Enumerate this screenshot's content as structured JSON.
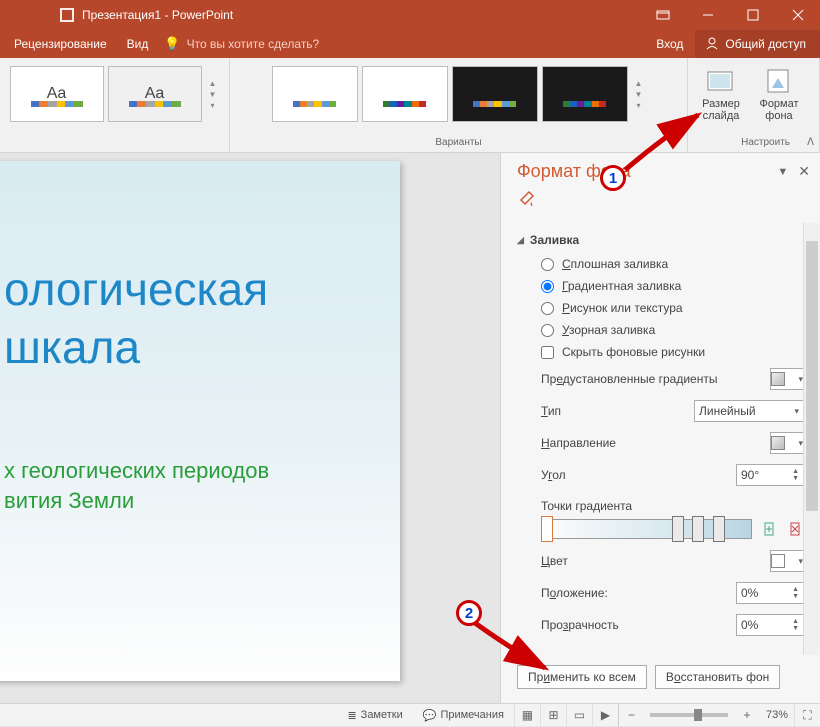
{
  "titlebar": {
    "title": "Презентация1 - PowerPoint"
  },
  "tabs": {
    "review": "Рецензирование",
    "view": "Вид",
    "tellme": "Что вы хотите сделать?",
    "signin": "Вход",
    "share": "Общий доступ"
  },
  "ribbon": {
    "variants_label": "Варианты",
    "customize_label": "Настроить",
    "size_slide": "Размер\nслайда",
    "format_bg": "Формат\nфона",
    "aa": "Aa"
  },
  "slide": {
    "heading_a": "ологическая",
    "heading_b": "шкала",
    "sub_a": "х геологических периодов",
    "sub_b": "вития Земли"
  },
  "pane": {
    "title": "Формат фона",
    "section_fill": "Заливка",
    "solid": "Сплошная заливка",
    "gradient": "Градиентная заливка",
    "picture": "Рисунок или текстура",
    "pattern": "Узорная заливка",
    "hide_bg": "Скрыть фоновые рисунки",
    "preset": "Предустановленные градиенты",
    "type": "Тип",
    "type_value": "Линейный",
    "direction": "Направление",
    "angle": "Угол",
    "angle_value": "90°",
    "stops": "Точки градиента",
    "color": "Цвет",
    "position": "Положение:",
    "position_value": "0%",
    "transparency": "Прозрачность",
    "transparency_value": "0%",
    "apply_all": "Применить ко всем",
    "reset": "Восстановить фон"
  },
  "status": {
    "notes": "Заметки",
    "comments": "Примечания",
    "zoom": "73%"
  },
  "callouts": {
    "one": "1",
    "two": "2"
  }
}
